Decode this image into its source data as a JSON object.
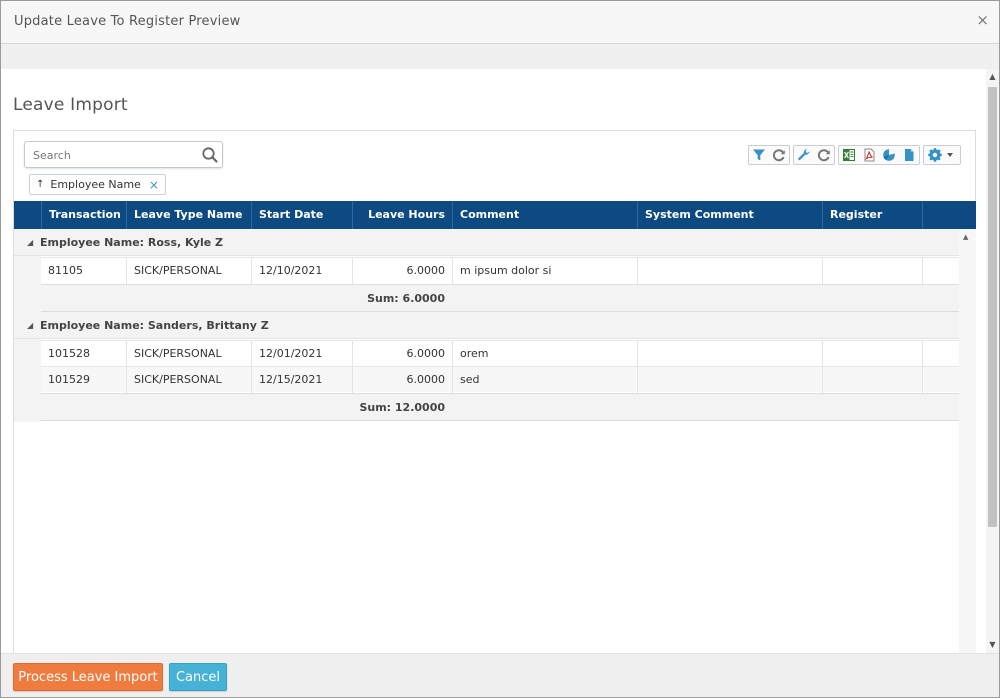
{
  "dialog": {
    "title": "Update Leave To Register Preview",
    "close_glyph": "×"
  },
  "page": {
    "title": "Leave Import"
  },
  "search": {
    "placeholder": "Search",
    "value": ""
  },
  "grouping_chip": {
    "arrow": "↑",
    "label": "Employee Name",
    "remove_glyph": "×"
  },
  "toolbar": {
    "icons": [
      "filter-icon",
      "refresh-icon",
      "wrench-icon",
      "reset-icon",
      "excel-export-icon",
      "pdf-export-icon",
      "chart-icon",
      "document-icon",
      "settings-icon"
    ],
    "icon_color": "#3592c6"
  },
  "grid": {
    "columns": [
      "Transaction",
      "Leave Type Name",
      "Start Date",
      "Leave Hours",
      "Comment",
      "System Comment",
      "Register"
    ],
    "groups": [
      {
        "label": "Employee Name: Ross, Kyle Z",
        "rows": [
          [
            "81105",
            "SICK/PERSONAL",
            "12/10/2021",
            "6.0000",
            "m ipsum dolor si",
            "",
            ""
          ]
        ],
        "sum": "Sum: 6.0000"
      },
      {
        "label": "Employee Name: Sanders, Brittany Z",
        "rows": [
          [
            "101528",
            "SICK/PERSONAL",
            "12/01/2021",
            "6.0000",
            "orem",
            "",
            ""
          ],
          [
            "101529",
            "SICK/PERSONAL",
            "12/15/2021",
            "6.0000",
            "sed",
            "",
            ""
          ]
        ],
        "sum": "Sum: 12.0000"
      }
    ],
    "header_color": "#0e4a82"
  },
  "footer": {
    "process_label": "Process Leave Import",
    "cancel_label": "Cancel",
    "process_color": "#f07b3f",
    "cancel_color": "#45b2d6"
  }
}
